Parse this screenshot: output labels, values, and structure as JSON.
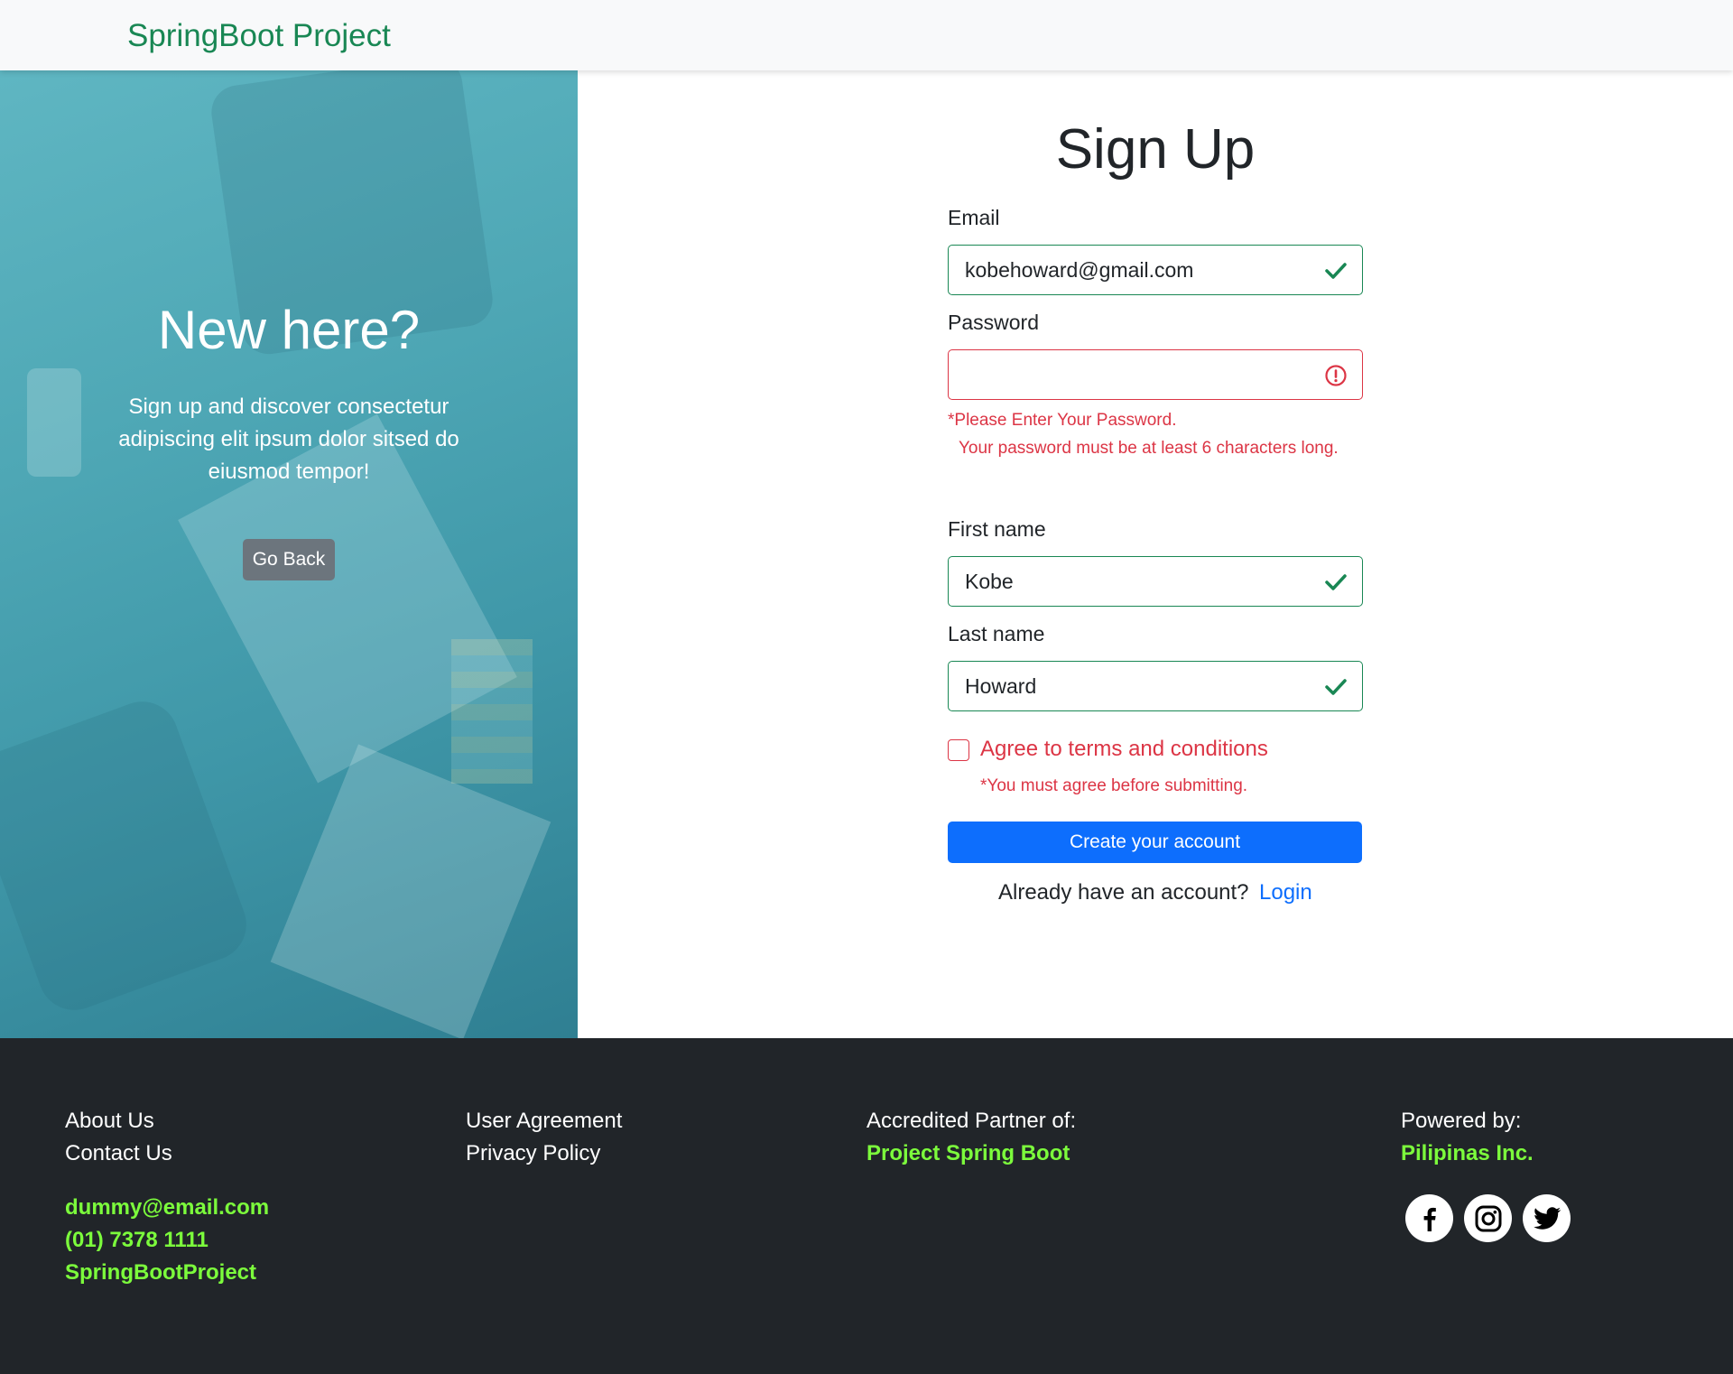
{
  "navbar": {
    "brand": "SpringBoot Project"
  },
  "hero": {
    "title": "New here?",
    "text": "Sign up and discover consectetur adipiscing elit ipsum dolor sitsed do eiusmod tempor!",
    "go_back": "Go Back"
  },
  "form": {
    "title": "Sign Up",
    "email": {
      "label": "Email",
      "value": "kobehoward@gmail.com",
      "status": "valid"
    },
    "password": {
      "label": "Password",
      "value": "",
      "status": "invalid",
      "error_required": "*Please Enter Your Password.",
      "error_length": "Your password must be at least 6 characters long."
    },
    "first_name": {
      "label": "First name",
      "value": "Kobe",
      "status": "valid"
    },
    "last_name": {
      "label": "Last name",
      "value": "Howard",
      "status": "valid"
    },
    "terms": {
      "label": "Agree to terms and conditions",
      "checked": false,
      "error": "*You must agree before submitting."
    },
    "submit": "Create your account",
    "already": "Already have an account?",
    "login": "Login"
  },
  "footer": {
    "col1": {
      "about": "About Us",
      "contact": "Contact Us",
      "email": "dummy@email.com",
      "phone": "(01) 7378 1111",
      "handle": "SpringBootProject"
    },
    "col2": {
      "agreement": "User Agreement",
      "privacy": "Privacy Policy"
    },
    "col3": {
      "label": "Accredited Partner of:",
      "partner": "Project Spring Boot"
    },
    "col4": {
      "label": "Powered by:",
      "company": "Pilipinas Inc."
    },
    "social": [
      "facebook-icon",
      "instagram-icon",
      "twitter-icon"
    ]
  },
  "colors": {
    "valid": "#198754",
    "invalid": "#dc3545",
    "primary": "#0d6efd",
    "accent_green": "#7cfc3c",
    "footer_bg": "#212529"
  }
}
